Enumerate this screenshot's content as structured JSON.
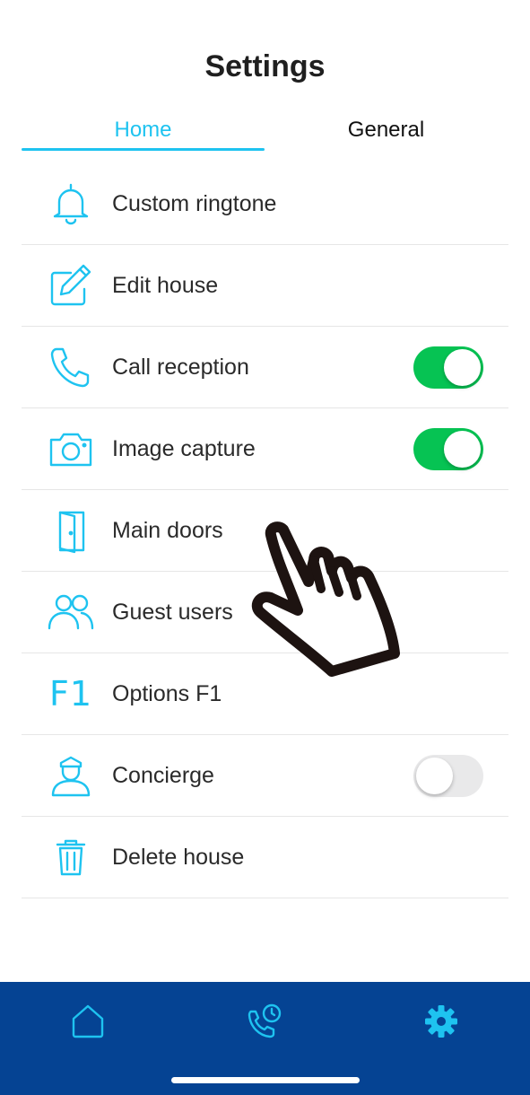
{
  "header": {
    "title": "Settings"
  },
  "tabs": [
    {
      "label": "Home",
      "active": true
    },
    {
      "label": "General",
      "active": false
    }
  ],
  "items": [
    {
      "icon": "bell-icon",
      "label": "Custom ringtone"
    },
    {
      "icon": "edit-icon",
      "label": "Edit house"
    },
    {
      "icon": "phone-icon",
      "label": "Call reception",
      "toggle": "on"
    },
    {
      "icon": "camera-icon",
      "label": "Image capture",
      "toggle": "on"
    },
    {
      "icon": "door-icon",
      "label": "Main doors"
    },
    {
      "icon": "users-icon",
      "label": "Guest users"
    },
    {
      "icon": "f1-icon",
      "icon_text": "F1",
      "label": "Options F1"
    },
    {
      "icon": "concierge-icon",
      "label": "Concierge",
      "toggle": "off"
    },
    {
      "icon": "trash-icon",
      "label": "Delete house"
    }
  ],
  "bottom_nav": [
    {
      "icon": "home-icon",
      "active": false
    },
    {
      "icon": "call-history-icon",
      "active": false
    },
    {
      "icon": "gear-icon",
      "active": true
    }
  ],
  "colors": {
    "accent": "#1ec3f0",
    "toggle_on": "#06c353",
    "toggle_off": "#e9e9ea",
    "bottom_bar": "#054393"
  }
}
